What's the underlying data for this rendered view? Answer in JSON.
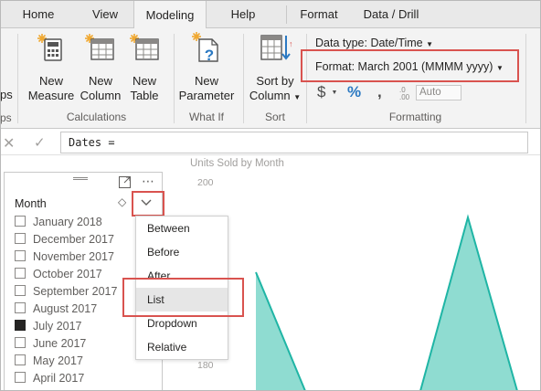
{
  "tabs": [
    {
      "label": "Home"
    },
    {
      "label": "View"
    },
    {
      "label": "Modeling"
    },
    {
      "label": "Help"
    },
    {
      "label": "Format"
    },
    {
      "label": "Data / Drill"
    }
  ],
  "ribbon": {
    "partial_label_top": "ps",
    "partial_label_bottom": "ps",
    "buttons": {
      "new_measure": {
        "line1": "New",
        "line2": "Measure"
      },
      "new_column": {
        "line1": "New",
        "line2": "Column"
      },
      "new_table": {
        "line1": "New",
        "line2": "Table"
      },
      "new_parameter": {
        "line1": "New",
        "line2": "Parameter"
      },
      "sort_by_column": {
        "line1": "Sort by",
        "line2": "Column"
      }
    },
    "groups": {
      "calculations": "Calculations",
      "what_if": "What If",
      "sort": "Sort",
      "formatting": "Formatting"
    },
    "data_type": "Data type: Date/Time",
    "format": "Format: March 2001 (MMMM yyyy)",
    "currency_symbol": "$",
    "percent_symbol": "%",
    "comma_symbol": ",",
    "auto_label": "Auto"
  },
  "formula_bar": {
    "value": "Dates ="
  },
  "slicer": {
    "header": "Month",
    "items": [
      {
        "label": "January 2018",
        "checked": false
      },
      {
        "label": "December 2017",
        "checked": false
      },
      {
        "label": "November 2017",
        "checked": false
      },
      {
        "label": "October 2017",
        "checked": false
      },
      {
        "label": "September 2017",
        "checked": false
      },
      {
        "label": "August 2017",
        "checked": false
      },
      {
        "label": "July 2017",
        "checked": true
      },
      {
        "label": "June 2017",
        "checked": false
      },
      {
        "label": "May 2017",
        "checked": false
      },
      {
        "label": "April 2017",
        "checked": false
      }
    ],
    "dropdown_options": [
      {
        "label": "Between",
        "selected": false
      },
      {
        "label": "Before",
        "selected": false
      },
      {
        "label": "After",
        "selected": false
      },
      {
        "label": "List",
        "selected": true
      },
      {
        "label": "Dropdown",
        "selected": false
      },
      {
        "label": "Relative",
        "selected": false
      }
    ]
  },
  "chart": {
    "title": "Units Sold by Month",
    "y_ticks": [
      "200",
      "180"
    ],
    "fill_color": "#8fdcd1",
    "line_color": "#1fb5a5"
  },
  "colors": {
    "highlight_box": "#d9534f",
    "ribbon_bg": "#f3f3f3"
  },
  "chart_data": {
    "type": "area",
    "title": "Units Sold by Month",
    "y_tick_labels": [
      "200",
      "180"
    ]
  }
}
